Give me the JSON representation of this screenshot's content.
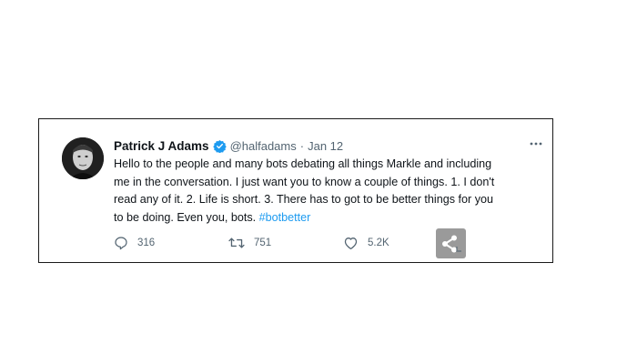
{
  "tweet": {
    "display_name": "Patrick J Adams",
    "handle": "@halfadams",
    "separator": "·",
    "date": "Jan 12",
    "more_icon": "more-horizontal-icon",
    "text_lines": [
      "Hello to the people and many bots debating all things Markle and including",
      "me in the conversation. I just want you to know a couple of things. 1. I don't",
      "read any of it. 2. Life is short. 3. There has to got to be better things for you",
      "to be doing. Even you, bots. "
    ],
    "hashtag": "#botbetter",
    "stats": {
      "replies": "316",
      "retweets": "751",
      "likes": "5.2K"
    }
  },
  "colors": {
    "verified_badge": "#1d9bf0",
    "hashtag": "#1d9bf0",
    "secondary_text": "#536471",
    "share_overlay": "#9a9a9a"
  },
  "icons": {
    "verified": "verified-badge-icon",
    "reply": "reply-icon",
    "retweet": "retweet-icon",
    "like": "heart-icon",
    "share": "share-icon"
  }
}
